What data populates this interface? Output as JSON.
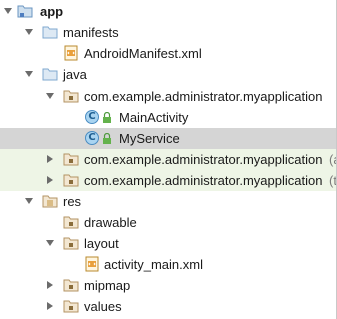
{
  "tree": {
    "app": {
      "label": "app"
    },
    "manifests": {
      "label": "manifests",
      "file": "AndroidManifest.xml"
    },
    "java": {
      "label": "java",
      "package_main": "com.example.administrator.myapplication",
      "classes": [
        "MainActivity",
        "MyService"
      ],
      "package_android_test": "com.example.administrator.myapplication",
      "package_android_test_suffix": "(a",
      "package_test": "com.example.administrator.myapplication",
      "package_test_suffix": "(t"
    },
    "res": {
      "label": "res",
      "folders": [
        "drawable",
        "layout",
        "mipmap",
        "values"
      ],
      "layout_file": "activity_main.xml"
    }
  },
  "colors": {
    "selected_row": "#d5d5d5",
    "test_row": "#eef5e6",
    "folder": "#7fa8cf",
    "class_icon": "#a9d4f1"
  }
}
